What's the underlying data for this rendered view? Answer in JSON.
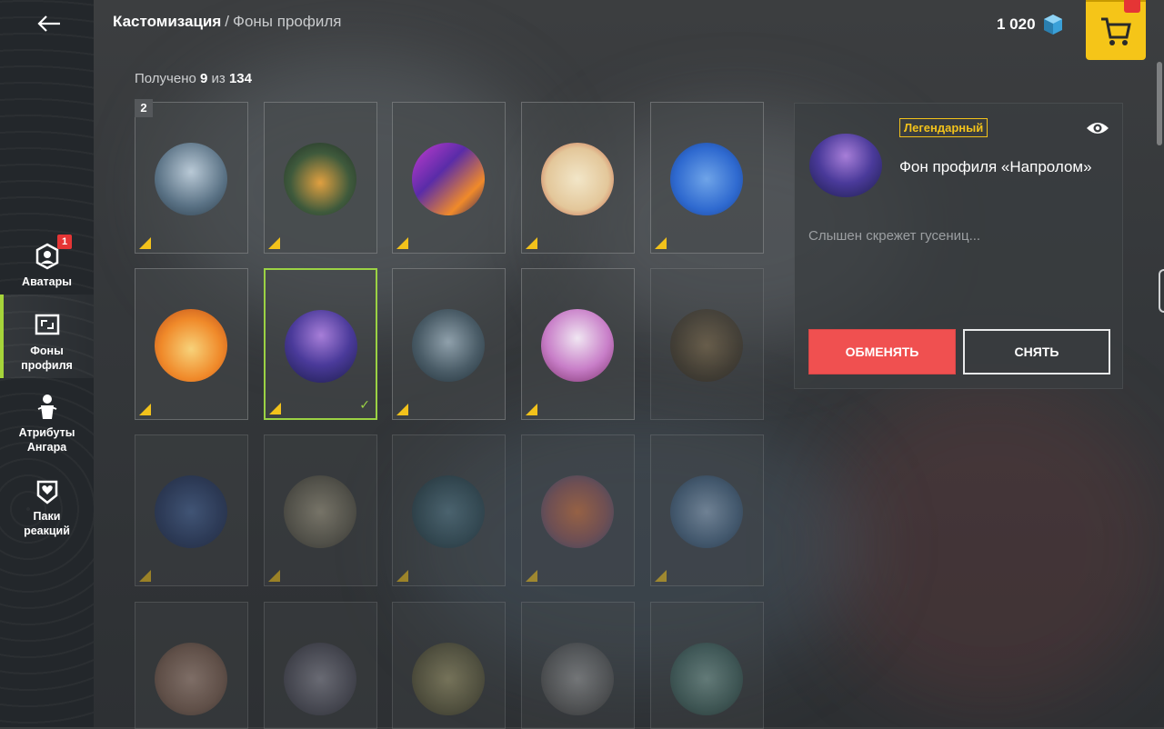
{
  "header": {
    "breadcrumb_root": "Кастомизация",
    "breadcrumb_sep": "/",
    "breadcrumb_current": "Фоны профиля",
    "currency_amount": "1 020",
    "currency_icon": "gold-cube-icon"
  },
  "sidebar": {
    "items": [
      {
        "label_line1": "Аватары",
        "label_line2": "",
        "badge": "1",
        "icon": "avatar-icon"
      },
      {
        "label_line1": "Фоны",
        "label_line2": "профиля",
        "badge": "",
        "icon": "profile-background-icon",
        "active": true
      },
      {
        "label_line1": "Атрибуты",
        "label_line2": "Ангара",
        "badge": "",
        "icon": "hangar-attribute-icon"
      },
      {
        "label_line1": "Паки",
        "label_line2": "реакций",
        "badge": "",
        "icon": "reaction-pack-icon"
      }
    ]
  },
  "collection": {
    "prefix": "Получено",
    "owned": "9",
    "mid": "из",
    "total": "134",
    "first_card_count": "2"
  },
  "detail": {
    "rarity": "Легендарный",
    "title": "Фон профиля «Напролом»",
    "description": "Слышен скрежет гусениц...",
    "swap_label": "ОБМЕНЯТЬ",
    "remove_label": "СНЯТЬ"
  },
  "colors": {
    "accent_green": "#9bd244",
    "legendary_gold": "#f2c21b",
    "swap_red": "#f05050",
    "shop_yellow": "#f5c518"
  }
}
